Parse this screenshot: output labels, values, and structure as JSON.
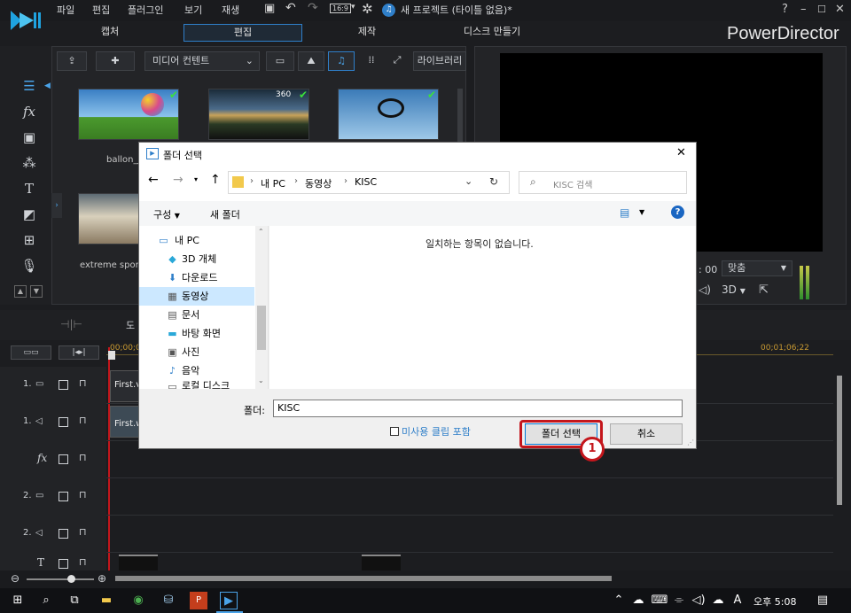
{
  "menu": {
    "items": [
      "파일",
      "편집",
      "플러그인",
      "보기",
      "재생"
    ],
    "aspect": "16:9",
    "title": "새 프로젝트 (타이틀 없음)*",
    "help": "?"
  },
  "modes": {
    "capture": "캡처",
    "edit": "편집",
    "produce": "제작",
    "disc": "디스크 만들기"
  },
  "brand": "PowerDirector",
  "library": {
    "content_dropdown": "미디어 컨텐트",
    "library_button": "라이브러리",
    "thumb2_badge": "360",
    "labels": [
      "ballon_j",
      "extreme spor"
    ]
  },
  "preview": {
    "time_suffix": ": 00",
    "fit_select": "맞춤",
    "mode_3d": "3D"
  },
  "toolbar": {
    "partial_label": "도"
  },
  "timeline": {
    "ruler_start": "00;00;0",
    "ruler_end": "00;01;06;22",
    "tracks": [
      "1.",
      "1.",
      "",
      "2.",
      "2.",
      ""
    ],
    "clip1_label": "First.v",
    "clip2_label": "First.w"
  },
  "dialog": {
    "title": "폴더 선택",
    "breadcrumb": [
      "내 PC",
      "동영상",
      "KISC"
    ],
    "search_placeholder": "KISC 검색",
    "organize": "구성",
    "new_folder": "새 폴더",
    "nav_items": [
      {
        "label": "내 PC",
        "icon": "computer-icon"
      },
      {
        "label": "3D 개체",
        "icon": "cube-icon"
      },
      {
        "label": "다운로드",
        "icon": "download-icon"
      },
      {
        "label": "동영상",
        "icon": "video-icon"
      },
      {
        "label": "문서",
        "icon": "document-icon"
      },
      {
        "label": "바탕 화면",
        "icon": "desktop-icon"
      },
      {
        "label": "사진",
        "icon": "picture-icon"
      },
      {
        "label": "음악",
        "icon": "music-icon"
      },
      {
        "label": "로컬 디스크",
        "icon": "disk-icon"
      }
    ],
    "empty_message": "일치하는 항목이 없습니다.",
    "folder_label": "폴더:",
    "folder_value": "KISC",
    "include_unused": "미사용 클립 포함",
    "select_button": "폴더 선택",
    "cancel_button": "취소",
    "step_marker": "1"
  },
  "taskbar": {
    "ime": "A",
    "clock": "오후 5:08"
  },
  "colors": {
    "accent": "#2f7fc9",
    "highlight_red": "#c4161c",
    "selection": "#cce8ff"
  }
}
